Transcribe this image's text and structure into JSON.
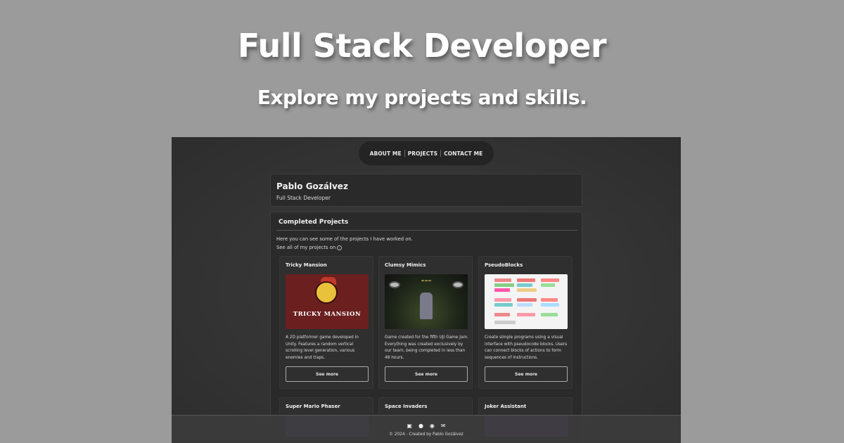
{
  "hero": {
    "title": "Full Stack Developer",
    "subtitle": "Explore my projects and skills."
  },
  "nav": {
    "items": [
      "ABOUT ME",
      "PROJECTS",
      "CONTACT ME"
    ]
  },
  "profile": {
    "name": "Pablo Gozálvez",
    "role": "Full Stack Developer"
  },
  "projects": {
    "title": "Completed Projects",
    "intro_line1": "Here you can see some of the projects I have worked on.",
    "intro_line2": "See all of my projects on",
    "github_icon": "github-icon",
    "cards": [
      {
        "name": "Tricky Mansion",
        "description": "A 2D platformer game developed in Unity. Features a random vertical scrolling level generation, various enemies and traps.",
        "image_text": "TRICKY MANSION",
        "button": "See more"
      },
      {
        "name": "Clumsy Mimics",
        "description": "Game created for the fifth UJI Game Jam. Everything was created exclusively by our team, being completed in less than 48 hours.",
        "image_text": "",
        "button": "See more"
      },
      {
        "name": "PseudoBlocks",
        "description": "Create simple programs using a visual interface with pseudocode blocks. Users can connect blocks of actions to form sequences of instructions.",
        "image_text": "",
        "button": "See more"
      }
    ],
    "row2": [
      {
        "name": "Super Mario Phaser"
      },
      {
        "name": "Space Invaders"
      },
      {
        "name": "Joker Assistant"
      }
    ]
  },
  "footer": {
    "icons": [
      "linkedin-icon",
      "github-icon",
      "itchio-icon",
      "mail-icon"
    ],
    "copyright": "© 2024 - Created by Pablo Gozálvez"
  },
  "colors": {
    "page_bg": "#9b9b9b",
    "panel_bg": "#2a2a2a",
    "text": "#f1f1f1"
  }
}
